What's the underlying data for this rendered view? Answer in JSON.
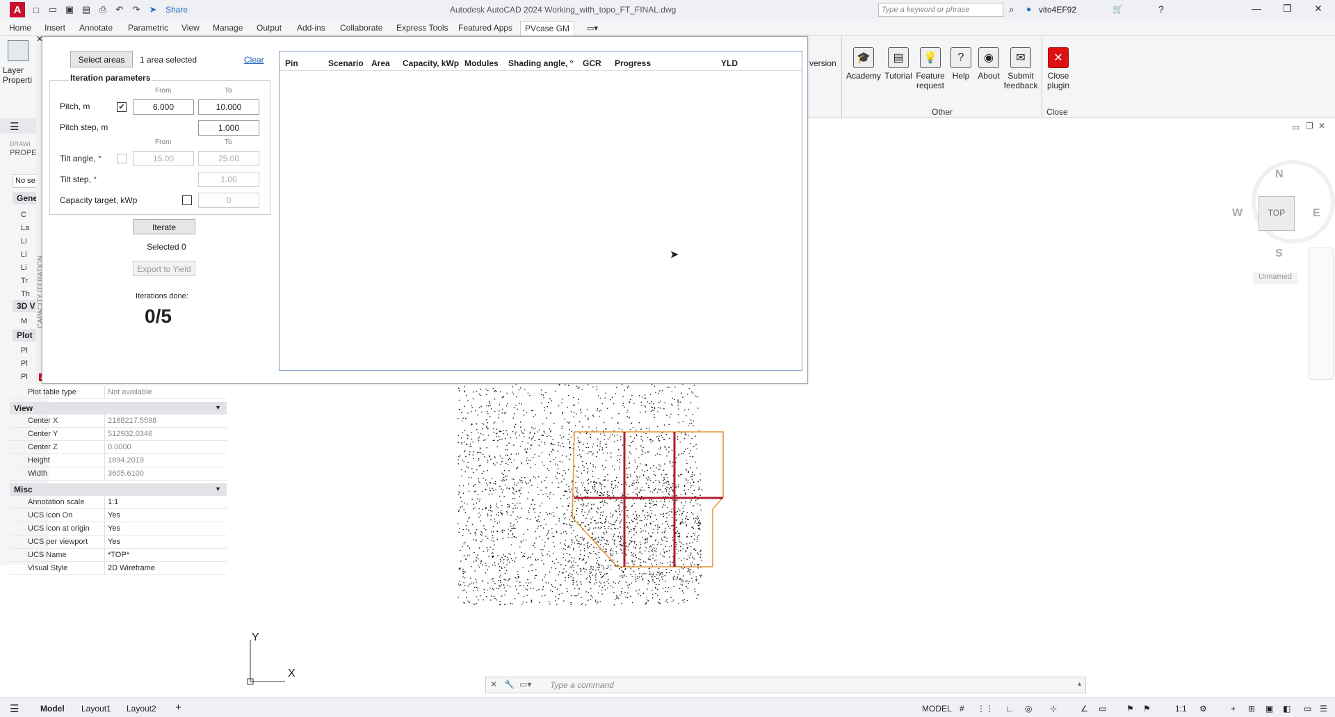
{
  "titlebar": {
    "app_title": "Autodesk AutoCAD 2024   Working_with_topo_FT_FINAL.dwg",
    "share": "Share",
    "search_placeholder": "Type a keyword or phrase",
    "user": "vito4EF92"
  },
  "menu": {
    "tabs": [
      "Home",
      "Insert",
      "Annotate",
      "Parametric",
      "View",
      "Manage",
      "Output",
      "Add-ins",
      "Collaborate",
      "Express Tools",
      "Featured Apps",
      "PVcase GM"
    ]
  },
  "ribbon": {
    "partial_label": "version",
    "buttons": [
      {
        "label": "Academy",
        "icon": "academy-icon"
      },
      {
        "label": "Tutorial",
        "icon": "tutorial-icon"
      },
      {
        "label": "Feature request",
        "icon": "lightbulb-icon"
      },
      {
        "label": "Help",
        "icon": "help-icon"
      },
      {
        "label": "About",
        "icon": "about-icon"
      },
      {
        "label": "Submit feedback",
        "icon": "feedback-icon"
      },
      {
        "label": "Close plugin",
        "icon": "close-plugin-icon"
      }
    ],
    "panel_other": "Other",
    "panel_close": "Close",
    "layer_props": "Layer Properti"
  },
  "dialog": {
    "side_title": "CAPACITY ITERATION",
    "select_areas": "Select areas",
    "area_status": "1 area selected",
    "clear": "Clear",
    "iteration_params": "Iteration parameters",
    "from": "From",
    "to": "To",
    "pitch_label": "Pitch, m",
    "pitch_from": "6.000",
    "pitch_to": "10.000",
    "pitch_step_label": "Pitch step, m",
    "pitch_step": "1.000",
    "tilt_label": "Tilt angle, °",
    "tilt_from": "15.00",
    "tilt_to": "25.00",
    "tilt_step_label": "Tilt step, °",
    "tilt_step": "1.00",
    "capacity_label": "Capacity target, kWp",
    "capacity_value": "0",
    "iterate": "Iterate",
    "selected": "Selected 0",
    "export": "Export to Yield",
    "iterations_label": "Iterations done:",
    "iterations_value": "0/5",
    "columns": [
      "Pin",
      "Scenario",
      "Area",
      "Capacity, kWp",
      "Modules",
      "Shading angle, °",
      "GCR",
      "Progress",
      "YLD"
    ]
  },
  "properties": {
    "drawing_label": "DRAWI",
    "palette_title": "PROPE",
    "no_selection": "No se",
    "general_header": "Gene",
    "view3d_header": "3D V",
    "plot_header": "Plot",
    "general_rows": [
      "C",
      "La",
      "Li",
      "Li",
      "Li",
      "Tr",
      "Th"
    ],
    "view3d_rows": [
      "M"
    ],
    "plot_rows": [
      "Pl",
      "Pl",
      "Pl"
    ],
    "plot_table": {
      "k": "Plot table type",
      "v": "Not available"
    },
    "view_header": "View",
    "view_rows": [
      {
        "k": "Center X",
        "v": "2168217.5598"
      },
      {
        "k": "Center Y",
        "v": "512932.0346"
      },
      {
        "k": "Center Z",
        "v": "0.0000"
      },
      {
        "k": "Height",
        "v": "1894.2019"
      },
      {
        "k": "Width",
        "v": "3605.6100"
      }
    ],
    "misc_header": "Misc",
    "misc_rows": [
      {
        "k": "Annotation scale",
        "v": "1:1"
      },
      {
        "k": "UCS icon On",
        "v": "Yes"
      },
      {
        "k": "UCS icon at origin",
        "v": "Yes"
      },
      {
        "k": "UCS per viewport",
        "v": "Yes"
      },
      {
        "k": "UCS Name",
        "v": "*TOP*"
      },
      {
        "k": "Visual Style",
        "v": "2D Wireframe"
      }
    ]
  },
  "viewcube": {
    "n": "N",
    "s": "S",
    "e": "E",
    "w": "W",
    "face": "TOP",
    "ucs": "Unnamed"
  },
  "axes": {
    "x": "X",
    "y": "Y"
  },
  "command": {
    "placeholder": "Type a command"
  },
  "status": {
    "tabs": [
      "Model",
      "Layout1",
      "Layout2"
    ],
    "model": "MODEL",
    "scale": "1:1"
  }
}
